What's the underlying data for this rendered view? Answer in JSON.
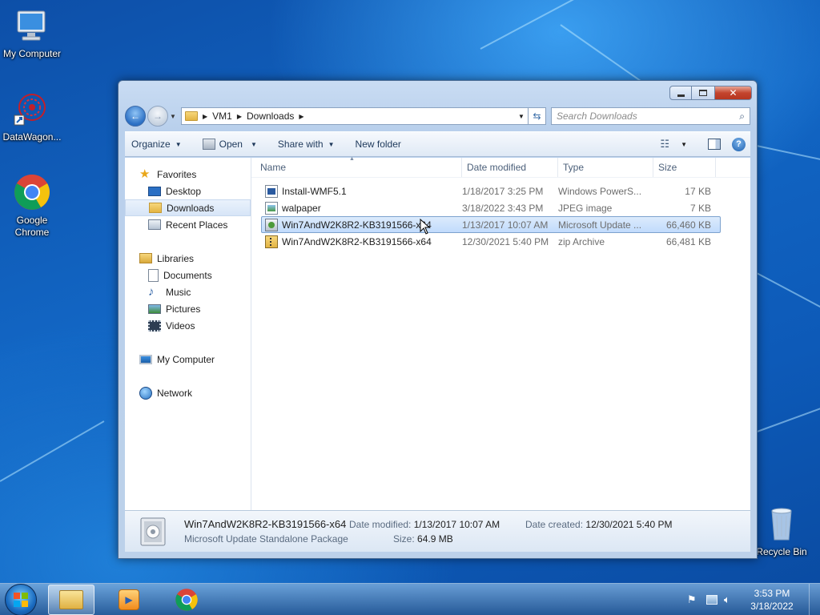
{
  "desktop": {
    "icons": [
      {
        "label": "My Computer"
      },
      {
        "label": "DataWagon..."
      },
      {
        "label": "Google Chrome"
      },
      {
        "label": "Recycle Bin"
      }
    ]
  },
  "window": {
    "address": {
      "crumbs": [
        "VM1",
        "Downloads"
      ]
    },
    "search": {
      "placeholder": "Search Downloads"
    },
    "toolbar": {
      "organize": "Organize",
      "open": "Open",
      "share_with": "Share with",
      "new_folder": "New folder"
    },
    "nav_pane": {
      "favorites": "Favorites",
      "desktop": "Desktop",
      "downloads": "Downloads",
      "recent_places": "Recent Places",
      "libraries": "Libraries",
      "documents": "Documents",
      "music": "Music",
      "pictures": "Pictures",
      "videos": "Videos",
      "my_computer": "My Computer",
      "network": "Network"
    },
    "columns": {
      "name": "Name",
      "date": "Date modified",
      "type": "Type",
      "size": "Size"
    },
    "files": [
      {
        "name": "Install-WMF5.1",
        "date": "1/18/2017 3:25 PM",
        "type": "Windows PowerS...",
        "size": "17 KB",
        "icon": "powershell-script-icon"
      },
      {
        "name": "walpaper",
        "date": "3/18/2022 3:43 PM",
        "type": "JPEG image",
        "size": "7 KB",
        "icon": "image-file-icon"
      },
      {
        "name": "Win7AndW2K8R2-KB3191566-x64",
        "date": "1/13/2017 10:07 AM",
        "type": "Microsoft Update ...",
        "size": "66,460 KB",
        "icon": "update-package-icon",
        "selected": true
      },
      {
        "name": "Win7AndW2K8R2-KB3191566-x64",
        "date": "12/30/2021 5:40 PM",
        "type": "zip Archive",
        "size": "66,481 KB",
        "icon": "zip-archive-icon"
      }
    ],
    "details": {
      "name": "Win7AndW2K8R2-KB3191566-x64",
      "type": "Microsoft Update Standalone Package",
      "date_modified_label": "Date modified:",
      "date_modified": "1/13/2017 10:07 AM",
      "size_label": "Size:",
      "size": "64.9 MB",
      "date_created_label": "Date created:",
      "date_created": "12/30/2021 5:40 PM"
    }
  },
  "taskbar": {
    "time": "3:53 PM",
    "date": "3/18/2022"
  }
}
